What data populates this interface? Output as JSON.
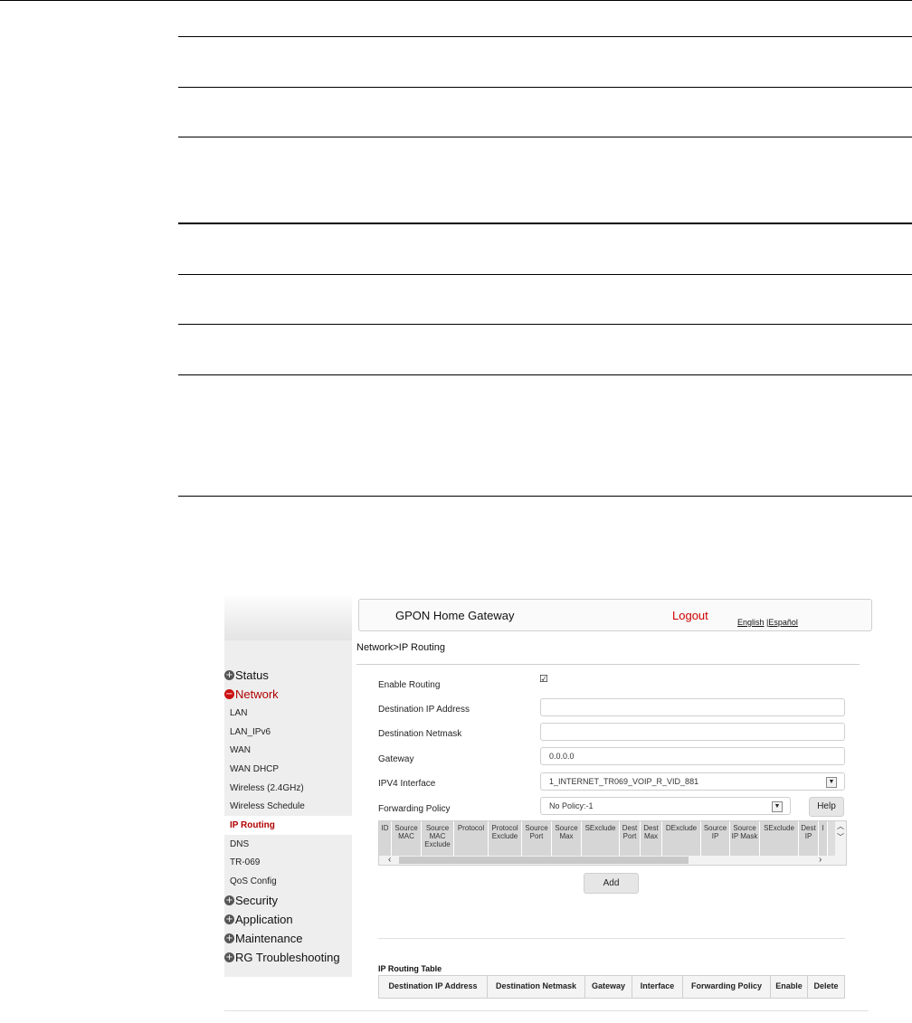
{
  "brand": "GPON Home Gateway",
  "logout": "Logout",
  "lang": {
    "english": "English",
    "sep": " |",
    "spanish": "Español"
  },
  "breadcrumb": "Network>IP Routing",
  "menu": {
    "status": "Status",
    "network": "Network",
    "network_items": [
      "LAN",
      "LAN_IPv6",
      "WAN",
      "WAN DHCP",
      "Wireless (2.4GHz)",
      "Wireless Schedule",
      "IP Routing",
      "DNS",
      "TR-069",
      "QoS Config"
    ],
    "security": "Security",
    "application": "Application",
    "maintenance": "Maintenance",
    "rg": "RG Troubleshooting"
  },
  "form": {
    "enable_routing": "Enable Routing",
    "enable_checked": "☑",
    "dest_ip": "Destination IP Address",
    "dest_ip_value": "",
    "dest_mask": "Destination Netmask",
    "dest_mask_value": "",
    "gateway": "Gateway",
    "gateway_value": "0.0.0.0",
    "ipv4_interface": "IPV4 Interface",
    "ipv4_interface_value": "1_INTERNET_TR069_VOIP_R_VID_881",
    "forwarding_policy": "Forwarding Policy",
    "forwarding_policy_value": "No Policy:-1",
    "help": "Help",
    "add": "Add"
  },
  "policy_columns": [
    "ID",
    "Source MAC",
    "Source MAC Exclude",
    "Protocol",
    "Protocol Exclude",
    "Source Port",
    "Source Max",
    "SExclude",
    "Dest Port",
    "Dest Max",
    "DExclude",
    "Source IP",
    "Source IP Mask",
    "SExclude",
    "Dest IP",
    "I"
  ],
  "routing_table": {
    "title": "IP Routing Table",
    "columns": [
      "Destination IP Address",
      "Destination Netmask",
      "Gateway",
      "Interface",
      "Forwarding Policy",
      "Enable",
      "Delete"
    ]
  },
  "colors": {
    "accent_red": "#cc0000",
    "sidebar_bg": "#eeeeee"
  }
}
